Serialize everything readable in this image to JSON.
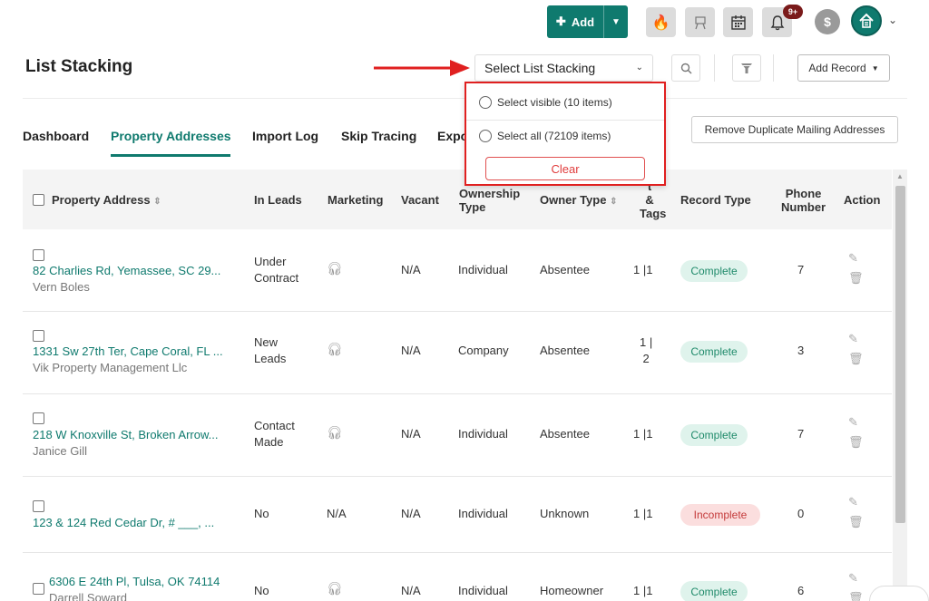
{
  "topbar": {
    "add_label": "Add",
    "notif_count": "9+",
    "icons": [
      "fire-icon",
      "easel-icon",
      "calendar-icon",
      "bell-icon",
      "dollar-icon"
    ]
  },
  "header": {
    "title": "List Stacking",
    "stack_select_value": "Select List Stacking",
    "add_record_label": "Add Record"
  },
  "dropdown": {
    "option_visible": "Select visible (10 items)",
    "option_all": "Select all (72109 items)",
    "clear_label": "Clear"
  },
  "tabs": [
    {
      "label": "Dashboard"
    },
    {
      "label": "Property Addresses"
    },
    {
      "label": "Import Log"
    },
    {
      "label": "Skip Tracing"
    },
    {
      "label": "Export"
    }
  ],
  "remove_duplicates_label": "Remove Duplicate Mailing Addresses",
  "table": {
    "headers": {
      "property_address": "Property Address",
      "in_leads": "In Leads",
      "marketing": "Marketing",
      "vacant": "Vacant",
      "ownership_type_1": "Ownership",
      "ownership_type_2": "Type",
      "owner_type": "Owner Type",
      "list_tags_1": "t",
      "list_tags_2": "&",
      "list_tags_3": "Tags",
      "record_type": "Record Type",
      "phone_number_1": "Phone",
      "phone_number_2": "Number",
      "action": "Action"
    },
    "rows": [
      {
        "address": "82 Charlies Rd, Yemassee, SC 29...",
        "owner": "Vern Boles",
        "in_leads_1": "Under",
        "in_leads_2": "Contract",
        "marketing": "",
        "vacant": "N/A",
        "ownership": "Individual",
        "owner_type": "Absentee",
        "tags_1": "1 |1",
        "tags_2": "",
        "record": "Complete",
        "phone": "7"
      },
      {
        "address": "1331 Sw 27th Ter, Cape Coral, FL ...",
        "owner": "Vik Property Management Llc",
        "in_leads_1": "New",
        "in_leads_2": "Leads",
        "marketing": "",
        "vacant": "N/A",
        "ownership": "Company",
        "owner_type": "Absentee",
        "tags_1": "1 |",
        "tags_2": "2",
        "record": "Complete",
        "phone": "3"
      },
      {
        "address": "218 W Knoxville St, Broken Arrow...",
        "owner": "Janice Gill",
        "in_leads_1": "Contact",
        "in_leads_2": "Made",
        "marketing": "",
        "vacant": "N/A",
        "ownership": "Individual",
        "owner_type": "Absentee",
        "tags_1": "1 |1",
        "tags_2": "",
        "record": "Complete",
        "phone": "7"
      },
      {
        "address": "123 & 124 Red Cedar Dr, # ___, ...",
        "owner": "",
        "in_leads_1": "No",
        "in_leads_2": "",
        "marketing": "N/A",
        "vacant": "N/A",
        "ownership": "Individual",
        "owner_type": "Unknown",
        "tags_1": "1 |1",
        "tags_2": "",
        "record": "Incomplete",
        "phone": "0"
      },
      {
        "address": "6306 E 24th Pl, Tulsa, OK 74114",
        "owner": "Darrell Soward",
        "in_leads_1": "No",
        "in_leads_2": "",
        "marketing": "",
        "vacant": "N/A",
        "ownership": "Individual",
        "owner_type": "Homeowner",
        "tags_1": "1 |1",
        "tags_2": "",
        "record": "Complete",
        "phone": "6"
      }
    ]
  },
  "colors": {
    "brand": "#0f7a6e",
    "highlight_border": "#e02020",
    "complete_bg": "#dff3ec",
    "incomplete_bg": "#fbdede"
  }
}
